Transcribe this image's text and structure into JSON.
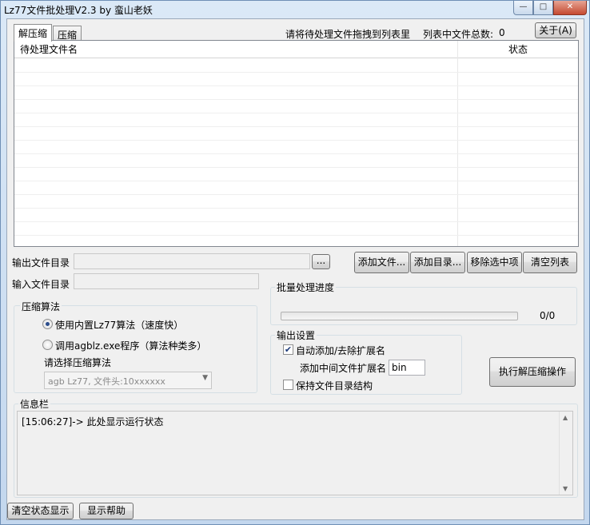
{
  "window": {
    "title": "Lz77文件批处理V2.3 by 蛮山老妖",
    "min_icon": "minimize-icon",
    "max_icon": "maximize-icon",
    "close_icon": "close-icon",
    "min_glyph": "—",
    "max_glyph": "□",
    "close_glyph": "✕"
  },
  "tabs": [
    {
      "label": "解压缩",
      "active": true
    },
    {
      "label": "压缩",
      "active": false
    }
  ],
  "header": {
    "drag_hint": "请将待处理文件拖拽到列表里",
    "file_count_label": "列表中文件总数:",
    "file_count": "0",
    "about_button": "关于(A)"
  },
  "file_list": {
    "columns": [
      "待处理文件名",
      "状态"
    ],
    "rows": []
  },
  "output_dir": {
    "label": "输出文件目录",
    "value": "",
    "browse_button": "..."
  },
  "input_dir": {
    "label": "输入文件目录",
    "value": ""
  },
  "list_buttons": {
    "add_file": "添加文件...",
    "add_dir": "添加目录...",
    "remove_selected": "移除选中项",
    "clear_list": "清空列表"
  },
  "compression": {
    "group_title": "压缩算法",
    "option_builtin": "使用内置Lz77算法（速度快）",
    "option_agblz": "调用agblz.exe程序（算法种类多）",
    "selected": "builtin",
    "algo_label": "请选择压缩算法",
    "algo_value": "agb Lz77, 文件头:10xxxxxx"
  },
  "progress": {
    "group_title": "批量处理进度",
    "text": "0/0",
    "fraction": 0
  },
  "output_settings": {
    "group_title": "输出设置",
    "auto_ext_label": "自动添加/去除扩展名",
    "auto_ext_checked": true,
    "mid_ext_label": "添加中间文件扩展名",
    "mid_ext_value": "bin",
    "keep_dir_label": "保持文件目录结构",
    "keep_dir_checked": false
  },
  "execute_button": "执行解压缩操作",
  "info": {
    "group_title": "信息栏",
    "log_line": "[15:06:27]-> 此处显示运行状态"
  },
  "bottom_buttons": {
    "clear_status": "清空状态显示",
    "show_help": "显示帮助"
  }
}
